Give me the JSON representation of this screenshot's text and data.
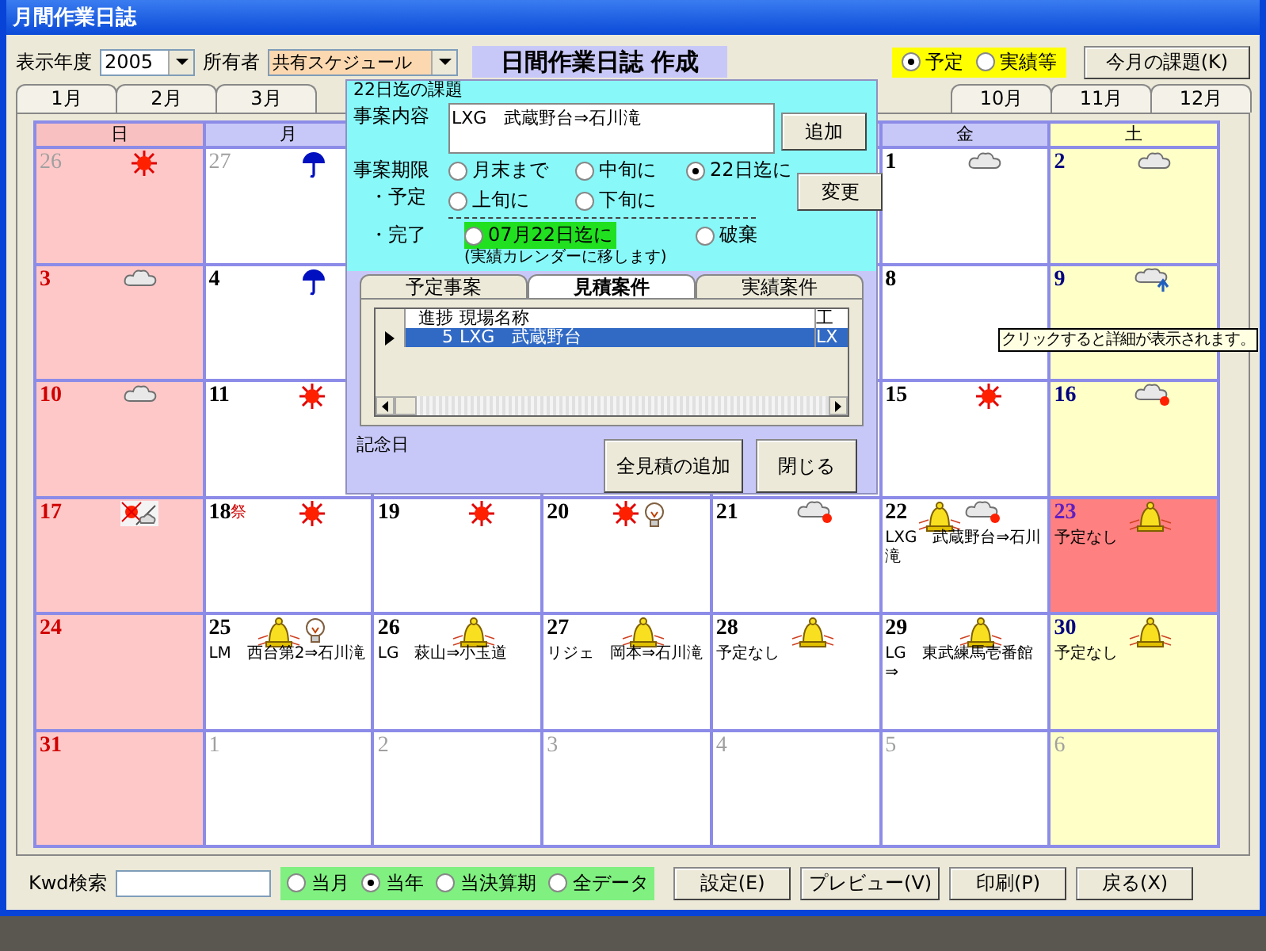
{
  "window": {
    "title": "月間作業日誌"
  },
  "toolbar": {
    "year_label": "表示年度",
    "year": "2005",
    "owner_label": "所有者",
    "owner": "共有スケジュール",
    "heading": "日間作業日誌 作成",
    "view_options": [
      {
        "label": "予定",
        "selected": true
      },
      {
        "label": "実績等",
        "selected": false
      }
    ],
    "task_button": "今月の課題(K)"
  },
  "month_tabs_left": [
    {
      "label": "1月",
      "selected": false
    },
    {
      "label": "2月",
      "selected": false
    },
    {
      "label": "3月",
      "selected": false
    }
  ],
  "month_tabs_right": [
    {
      "label": "10月",
      "selected": false
    },
    {
      "label": "11月",
      "selected": false
    },
    {
      "label": "12月",
      "selected": false
    }
  ],
  "calendar": {
    "weekdays": [
      {
        "label": "日",
        "kind": "sun"
      },
      {
        "label": "月",
        "kind": "weekday"
      },
      {
        "kind": "blank"
      },
      {
        "kind": "blank"
      },
      {
        "kind": "blank"
      },
      {
        "label": "金",
        "kind": "weekday"
      },
      {
        "label": "土",
        "kind": "sat"
      }
    ],
    "weeks": [
      [
        {
          "date": "26",
          "kind": "sun",
          "muted": true,
          "icons": [
            {
              "kind": "sunny"
            }
          ]
        },
        {
          "date": "27",
          "kind": "weekday",
          "muted": true,
          "icons": [
            {
              "kind": "rain"
            }
          ]
        },
        {
          "kind": "blank"
        },
        {
          "kind": "blank"
        },
        {
          "kind": "blank"
        },
        {
          "date": "1",
          "kind": "weekday",
          "muted": false,
          "icons": [
            {
              "kind": "cloudy"
            }
          ]
        },
        {
          "date": "2",
          "kind": "sat",
          "muted": false,
          "icons": [
            {
              "kind": "cloudy"
            }
          ]
        }
      ],
      [
        {
          "date": "3",
          "kind": "sun",
          "muted": false,
          "icons": [
            {
              "kind": "cloudy"
            }
          ]
        },
        {
          "date": "4",
          "kind": "weekday",
          "muted": false,
          "icons": [
            {
              "kind": "rain"
            }
          ]
        },
        {
          "kind": "blank"
        },
        {
          "kind": "blank"
        },
        {
          "kind": "blank"
        },
        {
          "date": "8",
          "kind": "weekday",
          "muted": false
        },
        {
          "date": "9",
          "kind": "sat",
          "muted": false,
          "icons": [
            {
              "kind": "cloudy-arrow"
            }
          ]
        }
      ],
      [
        {
          "date": "10",
          "kind": "sun",
          "muted": false,
          "icons": [
            {
              "kind": "cloudy"
            }
          ]
        },
        {
          "date": "11",
          "kind": "weekday",
          "muted": false,
          "icons": [
            {
              "kind": "sunny"
            }
          ]
        },
        {
          "kind": "blank"
        },
        {
          "kind": "blank"
        },
        {
          "kind": "blank"
        },
        {
          "date": "15",
          "kind": "weekday",
          "muted": false,
          "icons": [
            {
              "kind": "sunny"
            }
          ]
        },
        {
          "date": "16",
          "kind": "sat",
          "muted": false,
          "icons": [
            {
              "kind": "cloudy-sunny"
            }
          ]
        }
      ],
      [
        {
          "date": "17",
          "kind": "sun",
          "muted": false,
          "icons": [
            {
              "kind": "sunny-cloudy"
            }
          ]
        },
        {
          "date": "18",
          "holiday": "祭",
          "kind": "weekday",
          "muted": false,
          "icons": [
            {
              "kind": "sunny"
            }
          ]
        },
        {
          "date": "19",
          "kind": "weekday",
          "muted": false,
          "icons": [
            {
              "kind": "sunny"
            }
          ]
        },
        {
          "date": "20",
          "kind": "weekday",
          "muted": false,
          "icons": [
            {
              "kind": "sunny"
            },
            {
              "kind": "bulb"
            }
          ]
        },
        {
          "date": "21",
          "kind": "weekday",
          "muted": false,
          "icons": [
            {
              "kind": "cloudy-sunny"
            }
          ]
        },
        {
          "date": "22",
          "kind": "weekday",
          "muted": false,
          "icons": [
            {
              "kind": "bell"
            },
            {
              "kind": "cloudy-sunny"
            }
          ],
          "event": "LXG　武蔵野台⇒石川滝"
        },
        {
          "date": "23",
          "kind": "today",
          "muted": false,
          "icons": [
            {
              "kind": "bell"
            }
          ],
          "event": "予定なし"
        }
      ],
      [
        {
          "date": "24",
          "kind": "sun",
          "muted": false
        },
        {
          "date": "25",
          "kind": "weekday",
          "muted": false,
          "icons": [
            {
              "kind": "bell"
            },
            {
              "kind": "bulb"
            }
          ],
          "event": "LM　西台第2⇒石川滝"
        },
        {
          "date": "26",
          "kind": "weekday",
          "muted": false,
          "icons": [
            {
              "kind": "bell"
            }
          ],
          "event": "LG　萩山⇒小玉道"
        },
        {
          "date": "27",
          "kind": "weekday",
          "muted": false,
          "icons": [
            {
              "kind": "bell"
            }
          ],
          "event": "リジェ　岡本⇒石川滝"
        },
        {
          "date": "28",
          "kind": "weekday",
          "muted": false,
          "icons": [
            {
              "kind": "bell"
            }
          ],
          "event": "予定なし"
        },
        {
          "date": "29",
          "kind": "weekday",
          "muted": false,
          "icons": [
            {
              "kind": "bell"
            }
          ],
          "event": "LG　東武練馬壱番館⇒"
        },
        {
          "date": "30",
          "kind": "sat",
          "muted": false,
          "icons": [
            {
              "kind": "bell"
            }
          ],
          "event": "予定なし"
        }
      ],
      [
        {
          "date": "31",
          "kind": "sun",
          "muted": false
        },
        {
          "date": "1",
          "kind": "weekday",
          "muted": true
        },
        {
          "date": "2",
          "kind": "weekday",
          "muted": true
        },
        {
          "date": "3",
          "kind": "weekday",
          "muted": true
        },
        {
          "date": "4",
          "kind": "weekday",
          "muted": true
        },
        {
          "date": "5",
          "kind": "weekday",
          "muted": true
        },
        {
          "date": "6",
          "kind": "sat",
          "muted": true
        }
      ]
    ]
  },
  "tooltip": "クリックすると詳細が表示されます。",
  "task_dialog": {
    "group_title": "22日迄の課題",
    "content_label": "事案内容",
    "content": "LXG　武蔵野台⇒石川滝",
    "add_button": "追加",
    "deadline_label": "事案期限",
    "plan_label": "・予定",
    "deadline_options": [
      {
        "label": "月末まで",
        "selected": false
      },
      {
        "label": "中旬に",
        "selected": false
      },
      {
        "label": "22日迄に",
        "selected": true
      },
      {
        "label": "上旬に",
        "selected": false
      },
      {
        "label": "下旬に",
        "selected": false
      }
    ],
    "change_button": "変更",
    "done_label": "・完了",
    "done_options": [
      {
        "label": "07月22日迄に",
        "selected": false
      },
      {
        "label": "破棄",
        "selected": false
      }
    ],
    "done_note": "(実績カレンダーに移します)",
    "tabs": [
      {
        "label": "予定事案",
        "selected": false
      },
      {
        "label": "見積案件",
        "selected": true
      },
      {
        "label": "実績案件",
        "selected": false
      }
    ],
    "grid": {
      "columns": [
        "進捗",
        "現場名称",
        "工"
      ],
      "rows": [
        {
          "selected": true,
          "cells": [
            "5",
            "LXG　武蔵野台",
            "LX"
          ]
        }
      ]
    },
    "memo_label": "記念日",
    "add_all_button": "全見積の追加",
    "close_button": "閉じる"
  },
  "bottom_bar": {
    "search_label": "Kwd検索",
    "scope_options": [
      {
        "label": "当月",
        "selected": false
      },
      {
        "label": "当年",
        "selected": true
      },
      {
        "label": "当決算期",
        "selected": false
      },
      {
        "label": "全データ",
        "selected": false
      }
    ],
    "buttons": [
      "設定(E)",
      "プレビュー(V)",
      "印刷(P)",
      "戻る(X)"
    ]
  }
}
